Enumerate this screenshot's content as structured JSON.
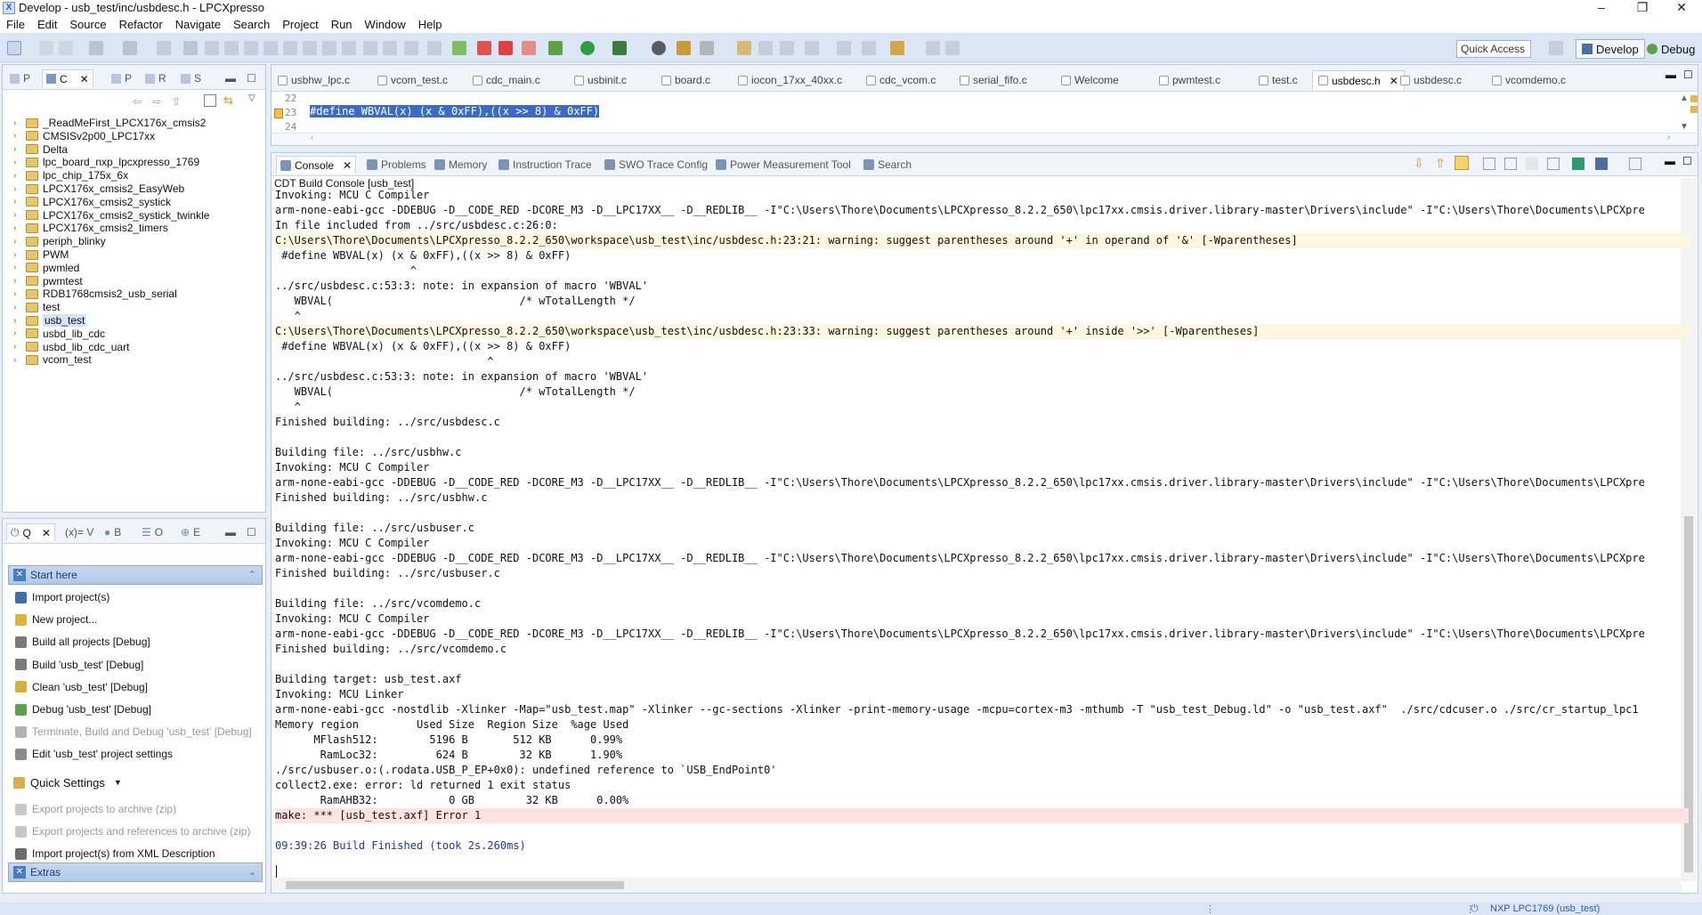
{
  "window": {
    "title": "Develop - usb_test/inc/usbdesc.h - LPCXpresso",
    "controls": [
      "–",
      "❐",
      "✕"
    ]
  },
  "menu": [
    "File",
    "Edit",
    "Source",
    "Refactor",
    "Navigate",
    "Search",
    "Project",
    "Run",
    "Window",
    "Help"
  ],
  "toolbar": {
    "quick_access_placeholder": "Quick Access",
    "perspectives": [
      {
        "label": "Develop",
        "active": true
      },
      {
        "label": "Debug",
        "active": false
      }
    ]
  },
  "project_panel": {
    "tabs": [
      "P",
      "C",
      "P",
      "R",
      "S"
    ],
    "items": [
      "_ReadMeFirst_LPCX176x_cmsis2",
      "CMSISv2p00_LPC17xx",
      "Delta",
      "lpc_board_nxp_lpcxpresso_1769",
      "lpc_chip_175x_6x",
      "LPCX176x_cmsis2_EasyWeb",
      "LPCX176x_cmsis2_systick",
      "LPCX176x_cmsis2_systick_twinkle",
      "LPCX176x_cmsis2_timers",
      "periph_blinky",
      "PWM",
      "pwmled",
      "pwmtest",
      "RDB1768cmsis2_usb_serial",
      "test",
      "usb_test",
      "usbd_lib_cdc",
      "usbd_lib_cdc_uart",
      "vcom_test"
    ],
    "selected": "usb_test"
  },
  "quickstart_panel": {
    "tabs": [
      "Q",
      "(x)= V",
      "B",
      "O",
      "E"
    ],
    "start_here": "Start here",
    "items": [
      {
        "label": "Import project(s)",
        "disabled": false
      },
      {
        "label": "New project...",
        "disabled": false
      },
      {
        "label": "Build all projects [Debug]",
        "disabled": false
      },
      {
        "label": "Build 'usb_test' [Debug]",
        "disabled": false
      },
      {
        "label": "Clean 'usb_test' [Debug]",
        "disabled": false
      },
      {
        "label": "Debug 'usb_test' [Debug]",
        "disabled": false
      },
      {
        "label": "Terminate, Build and Debug 'usb_test' [Debug]",
        "disabled": true
      },
      {
        "label": "Edit 'usb_test' project settings",
        "disabled": false
      }
    ],
    "quick_settings": "Quick Settings",
    "items2": [
      {
        "label": "Export projects to archive (zip)",
        "disabled": true
      },
      {
        "label": "Export projects and references to archive (zip)",
        "disabled": true
      },
      {
        "label": "Import project(s) from XML Description",
        "disabled": false
      }
    ],
    "extras": "Extras"
  },
  "editor": {
    "tabs": [
      "usbhw_lpc.c",
      "vcom_test.c",
      "cdc_main.c",
      "usbinit.c",
      "board.c",
      "iocon_17xx_40xx.c",
      "cdc_vcom.c",
      "serial_fifo.c",
      "Welcome",
      "pwmtest.c",
      "test.c",
      "usbdesc.h",
      "usbdesc.c",
      "vcomdemo.c"
    ],
    "active_tab": "usbdesc.h",
    "lines": [
      {
        "num": "22",
        "text": ""
      },
      {
        "num": "23",
        "text": "#define WBVAL(x) (x & 0xFF),((x >> 8) & 0xFF)"
      },
      {
        "num": "24",
        "text": ""
      }
    ]
  },
  "console_panel": {
    "tabs": [
      "Console",
      "Problems",
      "Memory",
      "Instruction Trace",
      "SWO Trace Config",
      "Power Measurement Tool",
      "Search"
    ],
    "active_tab": "Console",
    "title": "CDT Build Console [usb_test]",
    "lines": [
      {
        "text": "Invoking: MCU C Compiler",
        "kind": "normal"
      },
      {
        "text": "arm-none-eabi-gcc -DDEBUG -D__CODE_RED -DCORE_M3 -D__LPC17XX__ -D__REDLIB__ -I\"C:\\Users\\Thore\\Documents\\LPCXpresso_8.2.2_650\\lpc17xx.cmsis.driver.library-master\\Drivers\\include\" -I\"C:\\Users\\Thore\\Documents\\LPCXpre",
        "kind": "normal"
      },
      {
        "text": "In file included from ../src/usbdesc.c:26:0:",
        "kind": "normal"
      },
      {
        "text": "C:\\Users\\Thore\\Documents\\LPCXpresso_8.2.2_650\\workspace\\usb_test\\inc/usbdesc.h:23:21: warning: suggest parentheses around '+' in operand of '&' [-Wparentheses]",
        "kind": "warn"
      },
      {
        "text": " #define WBVAL(x) (x & 0xFF),((x >> 8) & 0xFF)",
        "kind": "normal"
      },
      {
        "text": "                     ^",
        "kind": "normal"
      },
      {
        "text": "../src/usbdesc.c:53:3: note: in expansion of macro 'WBVAL'",
        "kind": "normal"
      },
      {
        "text": "   WBVAL(                             /* wTotalLength */",
        "kind": "normal"
      },
      {
        "text": "   ^",
        "kind": "normal"
      },
      {
        "text": "C:\\Users\\Thore\\Documents\\LPCXpresso_8.2.2_650\\workspace\\usb_test\\inc/usbdesc.h:23:33: warning: suggest parentheses around '+' inside '>>' [-Wparentheses]",
        "kind": "warn"
      },
      {
        "text": " #define WBVAL(x) (x & 0xFF),((x >> 8) & 0xFF)",
        "kind": "normal"
      },
      {
        "text": "                                 ^",
        "kind": "normal"
      },
      {
        "text": "../src/usbdesc.c:53:3: note: in expansion of macro 'WBVAL'",
        "kind": "normal"
      },
      {
        "text": "   WBVAL(                             /* wTotalLength */",
        "kind": "normal"
      },
      {
        "text": "   ^",
        "kind": "normal"
      },
      {
        "text": "Finished building: ../src/usbdesc.c",
        "kind": "normal"
      },
      {
        "text": "",
        "kind": "normal"
      },
      {
        "text": "Building file: ../src/usbhw.c",
        "kind": "normal"
      },
      {
        "text": "Invoking: MCU C Compiler",
        "kind": "normal"
      },
      {
        "text": "arm-none-eabi-gcc -DDEBUG -D__CODE_RED -DCORE_M3 -D__LPC17XX__ -D__REDLIB__ -I\"C:\\Users\\Thore\\Documents\\LPCXpresso_8.2.2_650\\lpc17xx.cmsis.driver.library-master\\Drivers\\include\" -I\"C:\\Users\\Thore\\Documents\\LPCXpre",
        "kind": "normal"
      },
      {
        "text": "Finished building: ../src/usbhw.c",
        "kind": "normal"
      },
      {
        "text": "",
        "kind": "normal"
      },
      {
        "text": "Building file: ../src/usbuser.c",
        "kind": "normal"
      },
      {
        "text": "Invoking: MCU C Compiler",
        "kind": "normal"
      },
      {
        "text": "arm-none-eabi-gcc -DDEBUG -D__CODE_RED -DCORE_M3 -D__LPC17XX__ -D__REDLIB__ -I\"C:\\Users\\Thore\\Documents\\LPCXpresso_8.2.2_650\\lpc17xx.cmsis.driver.library-master\\Drivers\\include\" -I\"C:\\Users\\Thore\\Documents\\LPCXpre",
        "kind": "normal"
      },
      {
        "text": "Finished building: ../src/usbuser.c",
        "kind": "normal"
      },
      {
        "text": "",
        "kind": "normal"
      },
      {
        "text": "Building file: ../src/vcomdemo.c",
        "kind": "normal"
      },
      {
        "text": "Invoking: MCU C Compiler",
        "kind": "normal"
      },
      {
        "text": "arm-none-eabi-gcc -DDEBUG -D__CODE_RED -DCORE_M3 -D__LPC17XX__ -D__REDLIB__ -I\"C:\\Users\\Thore\\Documents\\LPCXpresso_8.2.2_650\\lpc17xx.cmsis.driver.library-master\\Drivers\\include\" -I\"C:\\Users\\Thore\\Documents\\LPCXpre",
        "kind": "normal"
      },
      {
        "text": "Finished building: ../src/vcomdemo.c",
        "kind": "normal"
      },
      {
        "text": "",
        "kind": "normal"
      },
      {
        "text": "Building target: usb_test.axf",
        "kind": "normal"
      },
      {
        "text": "Invoking: MCU Linker",
        "kind": "normal"
      },
      {
        "text": "arm-none-eabi-gcc -nostdlib -Xlinker -Map=\"usb_test.map\" -Xlinker --gc-sections -Xlinker -print-memory-usage -mcpu=cortex-m3 -mthumb -T \"usb_test_Debug.ld\" -o \"usb_test.axf\"  ./src/cdcuser.o ./src/cr_startup_lpc1",
        "kind": "normal"
      },
      {
        "text": "Memory region         Used Size  Region Size  %age Used",
        "kind": "normal"
      },
      {
        "text": "      MFlash512:        5196 B       512 KB      0.99%",
        "kind": "normal"
      },
      {
        "text": "       RamLoc32:         624 B        32 KB      1.90%",
        "kind": "normal"
      },
      {
        "text": "./src/usbuser.o:(.rodata.USB_P_EP+0x0): undefined reference to `USB_EndPoint0'",
        "kind": "normal"
      },
      {
        "text": "collect2.exe: error: ld returned 1 exit status",
        "kind": "normal"
      },
      {
        "text": "       RamAHB32:           0 GB        32 KB      0.00%",
        "kind": "normal"
      },
      {
        "text": "make: *** [usb_test.axf] Error 1",
        "kind": "err"
      },
      {
        "text": "",
        "kind": "normal"
      },
      {
        "text": "09:39:26 Build Finished (took 2s.260ms)",
        "kind": "info"
      }
    ]
  },
  "status_bar": {
    "target": "NXP LPC1769 (usb_test)"
  }
}
